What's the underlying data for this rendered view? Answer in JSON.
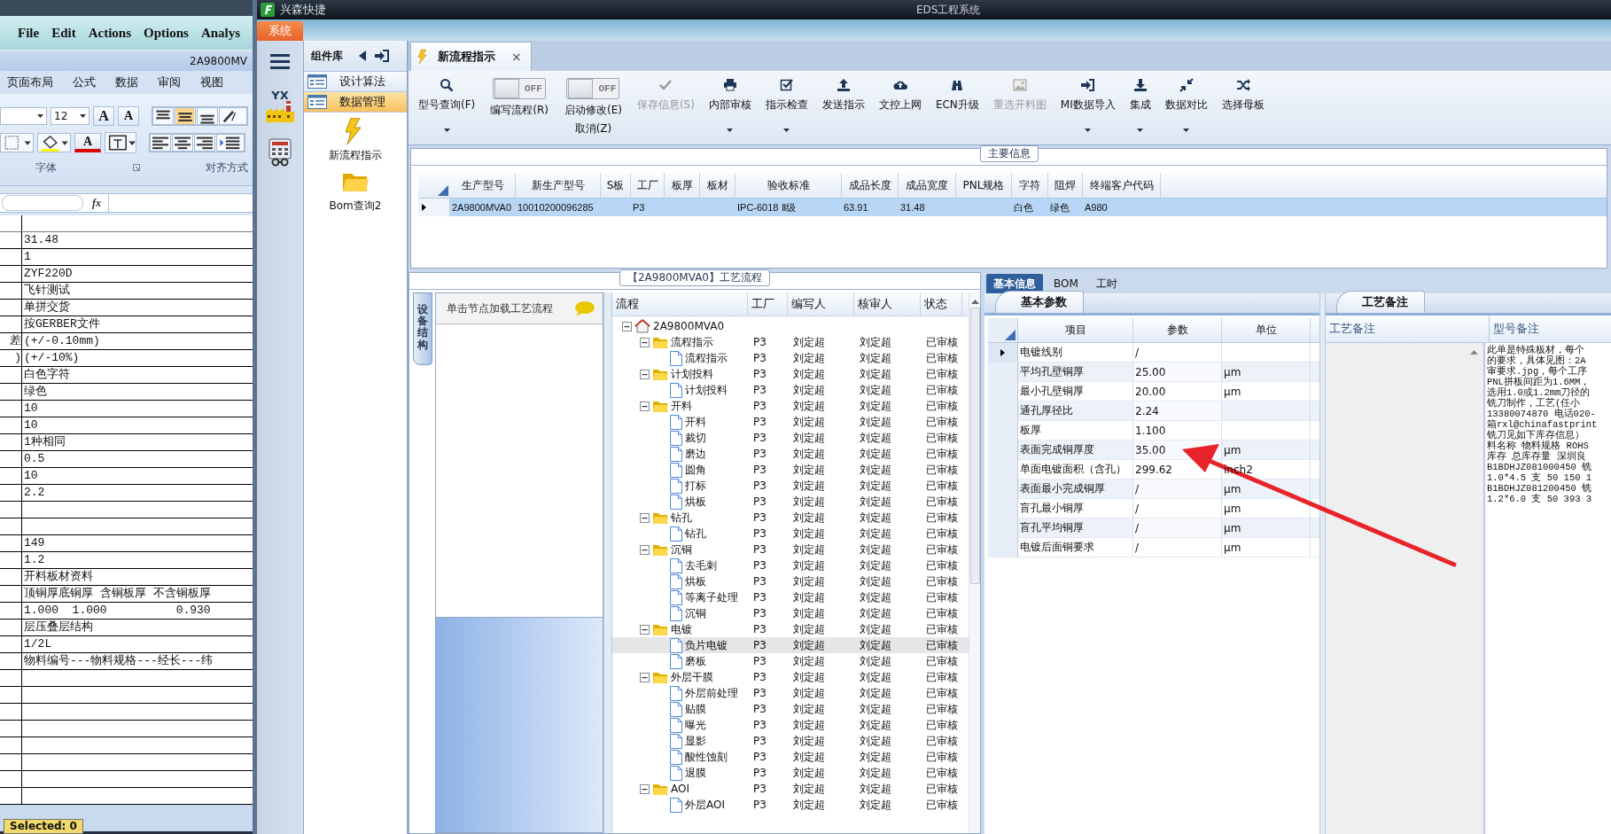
{
  "graphic_editor": {
    "menu": [
      "File",
      "Edit",
      "Actions",
      "Options",
      "Analys"
    ]
  },
  "spreadsheet": {
    "title": "2A9800MV",
    "tabs": [
      "页面布局",
      "公式",
      "数据",
      "审阅",
      "视图"
    ],
    "font_size": "12",
    "grow_label": "A",
    "shrink_label": "A",
    "font_color_label": "A",
    "group_labels": [
      "字体",
      "对齐方式"
    ],
    "formula_label": "fx",
    "rows": [
      {
        "column_2": "31.48"
      },
      {
        "column_2": "1"
      },
      {
        "column_2": "ZYF220D"
      },
      {
        "column_2": "飞针测试"
      },
      {
        "column_2": "单拼交货"
      },
      {
        "column_2": "按GERBER文件"
      },
      {
        "column_1": "差",
        "column_2": "(+/-0.10mm)"
      },
      {
        "column_1": ")",
        "column_2": "(+/-10%)"
      },
      {
        "column_2": "白色字符"
      },
      {
        "column_2": "绿色"
      },
      {
        "column_2": "10"
      },
      {
        "column_2": "10"
      },
      {
        "column_2": "1种相同"
      },
      {
        "column_2": "0.5"
      },
      {
        "column_2": "10"
      },
      {
        "column_2": "2.2"
      },
      {},
      {},
      {
        "column_2": "149"
      },
      {
        "column_2": "1.2"
      },
      {
        "column_2": "开料板材资料"
      },
      {
        "column_2": "顶铜厚底铜厚 含铜板厚 不含铜板厚"
      },
      {
        "column_2": "1.000  1.000          0.930"
      },
      {
        "column_2": "层压叠层结构"
      },
      {
        "column_2": "1/2L"
      },
      {
        "column_2": "物料编号---物料规格---经长---纬"
      }
    ],
    "status": "Selected: 0"
  },
  "app": {
    "title": "兴森快捷",
    "window_title": "EDS工程系统",
    "menu_tab": "系统",
    "logo_text": "YX"
  },
  "component_library": {
    "title": "组件库",
    "items": [
      {
        "label": "设计算法",
        "selected": false
      },
      {
        "label": "数据管理",
        "selected": true
      }
    ],
    "tiles": [
      {
        "label": "新流程指示"
      },
      {
        "label": "Bom查询2"
      }
    ]
  },
  "document_tab": {
    "label": "新流程指示",
    "close_glyph": "×"
  },
  "toolbar": [
    {
      "kind": "button",
      "label": "型号查询(F)",
      "disabled": false,
      "has_menu": true
    },
    {
      "kind": "toggle",
      "label": "编写流程(R)",
      "on": false,
      "state_label": "OFF"
    },
    {
      "kind": "toggle",
      "label": "启动修改(E)",
      "label_2": "取消(Z)",
      "on": false,
      "state_label": "OFF"
    },
    {
      "kind": "button",
      "label": "保存信息(S)",
      "disabled": true,
      "has_menu": false
    },
    {
      "kind": "button",
      "label": "内部审核",
      "disabled": false,
      "has_menu": true
    },
    {
      "kind": "button",
      "label": "指示检查",
      "disabled": false,
      "has_menu": true
    },
    {
      "kind": "button",
      "label": "发送指示",
      "disabled": false,
      "has_menu": false
    },
    {
      "kind": "button",
      "label": "文控上网",
      "disabled": false,
      "has_menu": false
    },
    {
      "kind": "button",
      "label": "ECN升级",
      "disabled": false,
      "has_menu": false
    },
    {
      "kind": "button",
      "label": "重选开料图",
      "disabled": true,
      "has_menu": false
    },
    {
      "kind": "button",
      "label": "MI数据导入",
      "disabled": false,
      "has_menu": true
    },
    {
      "kind": "button",
      "label": "集成",
      "disabled": false,
      "has_menu": true
    },
    {
      "kind": "button",
      "label": "数据对比",
      "disabled": false,
      "has_menu": true
    },
    {
      "kind": "button",
      "label": "选择母板",
      "disabled": false,
      "has_menu": false
    }
  ],
  "main_info": {
    "title": "主要信息",
    "columns": [
      "生产型号",
      "新生产型号",
      "S板",
      "工厂",
      "板厚",
      "板材",
      "验收标准",
      "成品长度",
      "成品宽度",
      "PNL规格",
      "字符",
      "阻焊",
      "终端客户代码"
    ],
    "rows": [
      {
        "selected": true,
        "cells": [
          "2A9800MVA0",
          "10010200096285",
          "",
          "P3",
          "",
          "",
          "IPC-6018 Ⅱ级",
          "63.91",
          "31.48",
          "",
          "白色",
          "绿色",
          "A980"
        ]
      }
    ]
  },
  "process": {
    "title": "【2A9800MVA0】工艺流程",
    "side_tab": "设备结构",
    "hint": "单击节点加载工艺流程",
    "columns": [
      "流程",
      "工厂",
      "编写人",
      "核审人",
      "状态"
    ],
    "root": {
      "label": "2A9800MVA0",
      "expanded": true,
      "selected": false,
      "children": [
        {
          "label": "流程指示",
          "factory": "P3",
          "writer": "刘定超",
          "reviewer": "刘定超",
          "status": "已审核",
          "selected": false,
          "expanded": true,
          "children": [
            {
              "label": "流程指示",
              "factory": "P3",
              "writer": "刘定超",
              "reviewer": "刘定超",
              "status": "已审核",
              "selected": false
            }
          ]
        },
        {
          "label": "计划投料",
          "factory": "P3",
          "writer": "刘定超",
          "reviewer": "刘定超",
          "status": "已审核",
          "selected": false,
          "expanded": true,
          "children": [
            {
              "label": "计划投料",
              "factory": "P3",
              "writer": "刘定超",
              "reviewer": "刘定超",
              "status": "已审核",
              "selected": false
            }
          ]
        },
        {
          "label": "开料",
          "factory": "P3",
          "writer": "刘定超",
          "reviewer": "刘定超",
          "status": "已审核",
          "selected": false,
          "expanded": true,
          "children": [
            {
              "label": "开料",
              "factory": "P3",
              "writer": "刘定超",
              "reviewer": "刘定超",
              "status": "已审核",
              "selected": false
            },
            {
              "label": "裁切",
              "factory": "P3",
              "writer": "刘定超",
              "reviewer": "刘定超",
              "status": "已审核",
              "selected": false
            },
            {
              "label": "磨边",
              "factory": "P3",
              "writer": "刘定超",
              "reviewer": "刘定超",
              "status": "已审核",
              "selected": false
            },
            {
              "label": "圆角",
              "factory": "P3",
              "writer": "刘定超",
              "reviewer": "刘定超",
              "status": "已审核",
              "selected": false
            },
            {
              "label": "打标",
              "factory": "P3",
              "writer": "刘定超",
              "reviewer": "刘定超",
              "status": "已审核",
              "selected": false
            },
            {
              "label": "烘板",
              "factory": "P3",
              "writer": "刘定超",
              "reviewer": "刘定超",
              "status": "已审核",
              "selected": false
            }
          ]
        },
        {
          "label": "钻孔",
          "factory": "P3",
          "writer": "刘定超",
          "reviewer": "刘定超",
          "status": "已审核",
          "selected": false,
          "expanded": true,
          "children": [
            {
              "label": "钻孔",
              "factory": "P3",
              "writer": "刘定超",
              "reviewer": "刘定超",
              "status": "已审核",
              "selected": false
            }
          ]
        },
        {
          "label": "沉铜",
          "factory": "P3",
          "writer": "刘定超",
          "reviewer": "刘定超",
          "status": "已审核",
          "selected": false,
          "expanded": true,
          "children": [
            {
              "label": "去毛刺",
              "factory": "P3",
              "writer": "刘定超",
              "reviewer": "刘定超",
              "status": "已审核",
              "selected": false
            },
            {
              "label": "烘板",
              "factory": "P3",
              "writer": "刘定超",
              "reviewer": "刘定超",
              "status": "已审核",
              "selected": false
            },
            {
              "label": "等离子处理",
              "factory": "P3",
              "writer": "刘定超",
              "reviewer": "刘定超",
              "status": "已审核",
              "selected": false
            },
            {
              "label": "沉铜",
              "factory": "P3",
              "writer": "刘定超",
              "reviewer": "刘定超",
              "status": "已审核",
              "selected": false
            }
          ]
        },
        {
          "label": "电镀",
          "factory": "P3",
          "writer": "刘定超",
          "reviewer": "刘定超",
          "status": "已审核",
          "selected": false,
          "expanded": true,
          "children": [
            {
              "label": "负片电镀",
              "factory": "P3",
              "writer": "刘定超",
              "reviewer": "刘定超",
              "status": "已审核",
              "selected": true
            },
            {
              "label": "磨板",
              "factory": "P3",
              "writer": "刘定超",
              "reviewer": "刘定超",
              "status": "已审核",
              "selected": false
            }
          ]
        },
        {
          "label": "外层干膜",
          "factory": "P3",
          "writer": "刘定超",
          "reviewer": "刘定超",
          "status": "已审核",
          "selected": false,
          "expanded": true,
          "children": [
            {
              "label": "外层前处理",
              "factory": "P3",
              "writer": "刘定超",
              "reviewer": "刘定超",
              "status": "已审核",
              "selected": false
            },
            {
              "label": "贴膜",
              "factory": "P3",
              "writer": "刘定超",
              "reviewer": "刘定超",
              "status": "已审核",
              "selected": false
            },
            {
              "label": "曝光",
              "factory": "P3",
              "writer": "刘定超",
              "reviewer": "刘定超",
              "status": "已审核",
              "selected": false
            },
            {
              "label": "显影",
              "factory": "P3",
              "writer": "刘定超",
              "reviewer": "刘定超",
              "status": "已审核",
              "selected": false
            },
            {
              "label": "酸性蚀刻",
              "factory": "P3",
              "writer": "刘定超",
              "reviewer": "刘定超",
              "status": "已审核",
              "selected": false
            },
            {
              "label": "退膜",
              "factory": "P3",
              "writer": "刘定超",
              "reviewer": "刘定超",
              "status": "已审核",
              "selected": false
            }
          ]
        },
        {
          "label": "AOI",
          "factory": "P3",
          "writer": "刘定超",
          "reviewer": "刘定超",
          "status": "已审核",
          "selected": false,
          "expanded": true,
          "children": [
            {
              "label": "外层AOI",
              "factory": "P3",
              "writer": "刘定超",
              "reviewer": "刘定超",
              "status": "已审核",
              "selected": false
            }
          ]
        }
      ]
    }
  },
  "detail_tabs": [
    {
      "label": "基本信息",
      "selected": true
    },
    {
      "label": "BOM",
      "selected": false
    },
    {
      "label": "工时",
      "selected": false
    }
  ],
  "parameters": {
    "title": "基本参数",
    "columns": [
      "项目",
      "参数",
      "单位"
    ],
    "rows": [
      {
        "item": "电镀线别",
        "value": "/",
        "selected": true
      },
      {
        "item": "平均孔壁铜厚",
        "value": "25.00",
        "unit": "μm",
        "selected": false
      },
      {
        "item": "最小孔壁铜厚",
        "value": "20.00",
        "unit": "μm",
        "selected": false
      },
      {
        "item": "通孔厚径比",
        "value": "2.24",
        "selected": false
      },
      {
        "item": "板厚",
        "value": "1.100",
        "selected": false
      },
      {
        "item": "表面完成铜厚度",
        "value": "35.00",
        "unit": "μm",
        "selected": false
      },
      {
        "item": "单面电镀面积（含孔）",
        "value": "299.62",
        "unit": "inch2",
        "selected": false
      },
      {
        "item": "表面最小完成铜厚",
        "value": "/",
        "unit": "μm",
        "selected": false
      },
      {
        "item": "盲孔最小铜厚",
        "value": "/",
        "unit": "μm",
        "selected": false
      },
      {
        "item": "盲孔平均铜厚",
        "value": "/",
        "unit": "μm",
        "selected": false
      },
      {
        "item": "电镀后面铜要求",
        "value": "/",
        "unit": "μm",
        "selected": false
      }
    ]
  },
  "remarks": {
    "title": "工艺备注",
    "columns": [
      "工艺备注",
      "型号备注"
    ],
    "model_remark_lines": [
      "此单是特殊板材，每个",
      "的要求，具体见图：2A",
      "审要求.jpg，每个工序",
      "PNL拼板间距为1.6MM，",
      "选用1.0或1.2mm刀径的",
      "铣刀制作，工艺(任小",
      "13380074870 电话020-",
      "箱rxl@chinafastprint",
      "铣刀见如下库存信息）",
      "料名称 物料规格 ROHS",
      "库存 总库存量 深圳良",
      "B1BDHJZ081000450 铣",
      "1.0*4.5  支 50 150 1",
      "B1BDHJZ081200450 铣",
      "1.2*6.0  支 50 393 3"
    ]
  }
}
